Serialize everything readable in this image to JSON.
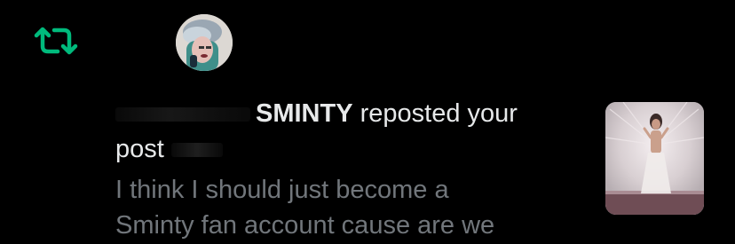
{
  "notification": {
    "actor_name": "SMINTY",
    "action_text": " reposted your",
    "object_text": "post",
    "post_preview_lines": [
      "I think I should just become a",
      "Sminty fan account cause are we"
    ]
  },
  "icons": {
    "repost": "repost-icon",
    "avatar": "avatar-image",
    "thumbnail": "post-thumbnail-image"
  },
  "colors": {
    "background": "#000000",
    "repost_icon": "#00ba7c",
    "primary_text": "#e7e9ea",
    "secondary_text": "#71767b"
  }
}
